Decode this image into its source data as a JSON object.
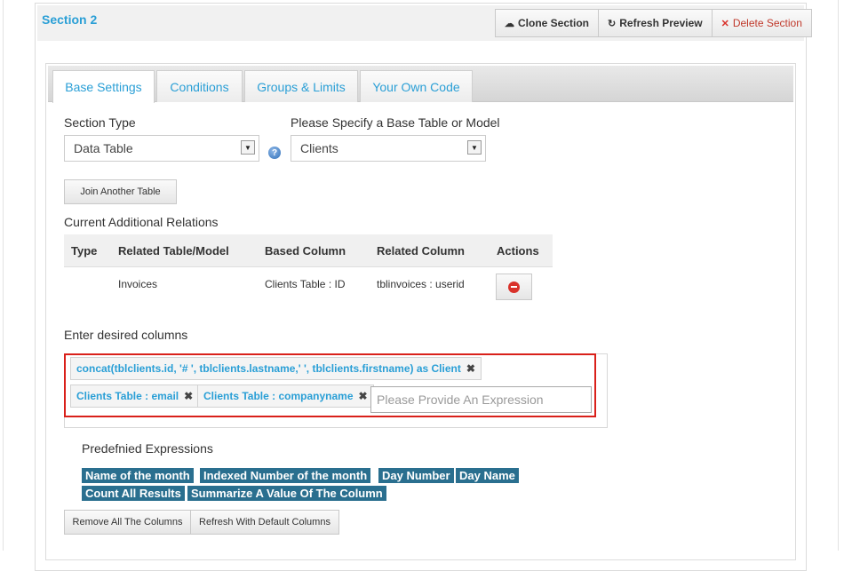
{
  "section": {
    "title": "Section 2",
    "buttons": {
      "clone": "Clone Section",
      "refresh": "Refresh Preview",
      "delete": "Delete Section"
    }
  },
  "tabs": [
    {
      "label": "Base Settings",
      "active": true
    },
    {
      "label": "Conditions",
      "active": false
    },
    {
      "label": "Groups & Limits",
      "active": false
    },
    {
      "label": "Your Own Code",
      "active": false
    }
  ],
  "form": {
    "section_type_label": "Section Type",
    "section_type_value": "Data Table",
    "base_table_label": "Please Specify a Base Table or Model",
    "base_table_value": "Clients",
    "help_icon": "?",
    "join_button": "Join Another Table"
  },
  "relations": {
    "title": "Current Additional Relations",
    "headers": [
      "Type",
      "Related Table/Model",
      "Based Column",
      "Related Column",
      "Actions"
    ],
    "rows": [
      {
        "type": "",
        "related_table": "Invoices",
        "based_column": "Clients Table : ID",
        "related_column": "tblinvoices : userid"
      }
    ]
  },
  "columns": {
    "title": "Enter desired columns",
    "chips": [
      "concat(tblclients.id, '# ', tblclients.lastname,' ', tblclients.firstname) as Client",
      "Clients Table : email",
      "Clients Table : companyname"
    ],
    "input_placeholder": "Please Provide An Expression",
    "remove_glyph": "✖"
  },
  "predefined": {
    "title": "Predefnied Expressions",
    "expressions": [
      "Name of the month",
      "Indexed Number of the month",
      "Day Number",
      "Day Name",
      "Count All Results",
      "Summarize A Value Of The Column"
    ]
  },
  "bottom_buttons": {
    "remove_all": "Remove All The Columns",
    "refresh_default": "Refresh With Default Columns"
  },
  "colors": {
    "accent": "#2a9fd6",
    "badge": "#2a6f8f",
    "danger": "#d9322b",
    "highlight": "#d9201a"
  },
  "icons": {
    "clone": "cloud-icon",
    "refresh": "refresh-icon",
    "delete": "close-icon",
    "help": "help-icon",
    "row_delete": "minus-circle-icon",
    "dropdown": "caret-down-icon",
    "chip_remove": "close-icon"
  }
}
